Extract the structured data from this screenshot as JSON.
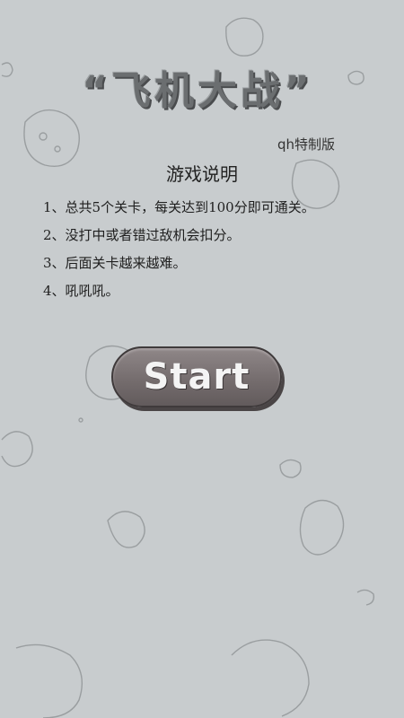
{
  "game": {
    "title": "“飞机大战”",
    "edition": "qh特制版"
  },
  "instructions": {
    "heading": "游戏说明",
    "rules": [
      "1、总共5个关卡，每关达到100分即可通关。",
      "2、没打中或者错过敌机会扣分。",
      "3、后面关卡越来越难。",
      "4、吼吼吼。"
    ]
  },
  "start_button": {
    "label": "Start"
  },
  "colors": {
    "background": "#c8ccce",
    "button": "#756d6e",
    "title": "#6b6e70"
  }
}
